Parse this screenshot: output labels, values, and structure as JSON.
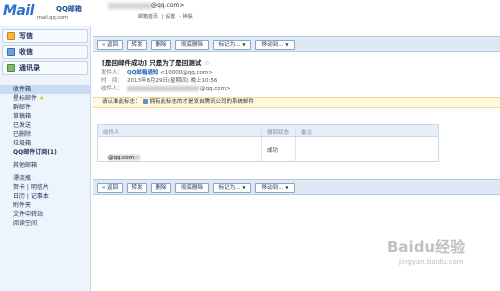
{
  "header": {
    "logo_text": "Mail",
    "logo_cn": "QQ邮箱",
    "logo_sub": "mail.qq.com",
    "account_domain": "@qq.com>",
    "top_links": [
      "邮箱首页",
      "设置",
      "换肤"
    ]
  },
  "sidebar": {
    "buttons": [
      {
        "label": "写信",
        "icon": "pencil-icon"
      },
      {
        "label": "收信",
        "icon": "inbox-icon"
      },
      {
        "label": "通讯录",
        "icon": "contacts-icon"
      }
    ],
    "folders": [
      {
        "label": "收件箱",
        "active": true
      },
      {
        "label": "星标邮件",
        "star": true
      },
      {
        "label": "群邮件"
      },
      {
        "label": "草稿箱"
      },
      {
        "label": "已发送"
      },
      {
        "label": "已删除"
      },
      {
        "label": "垃圾箱"
      },
      {
        "label": "QQ邮件订阅(1)",
        "bold": true
      },
      {
        "label": "其他邮箱",
        "sep": true
      },
      {
        "label": "漂流瓶",
        "sep": true
      },
      {
        "label": "贺卡 | 明信片"
      },
      {
        "label": "日历 | 记事本"
      },
      {
        "label": "附件夹"
      },
      {
        "label": "文件中转站"
      },
      {
        "label": "阅读空间"
      }
    ]
  },
  "toolbar": {
    "back": "« 返回",
    "forward": "转发",
    "delete": "删除",
    "delete_forever": "彻底删除",
    "mark_as": "标记为...",
    "move_to": "移动到..."
  },
  "mail": {
    "subject": "[是回邮件成功] 只是为了是回测试",
    "star": "☆",
    "from_label": "发件人：",
    "from_name": "QQ邮箱通知",
    "from_addr": "<10000@qq.com>",
    "time_label": "时　间：",
    "time_value": "2013年8月29日(星期四) 晚上10:56",
    "to_label": "收件人：",
    "to_value": "@qq.com>",
    "notice_prefix": "请认准此标志：",
    "notice_text": "拥有此标志的才是发自腾讯公司的系统邮件"
  },
  "recipients_table": {
    "headers": [
      "收件人",
      "撤回状态",
      "备注"
    ],
    "rows": [
      {
        "recipient": "@qq.com",
        "status": "成功",
        "note": ""
      }
    ]
  },
  "watermark": {
    "logo": "Baidu经验",
    "url": "jingyan.baidu.com"
  }
}
